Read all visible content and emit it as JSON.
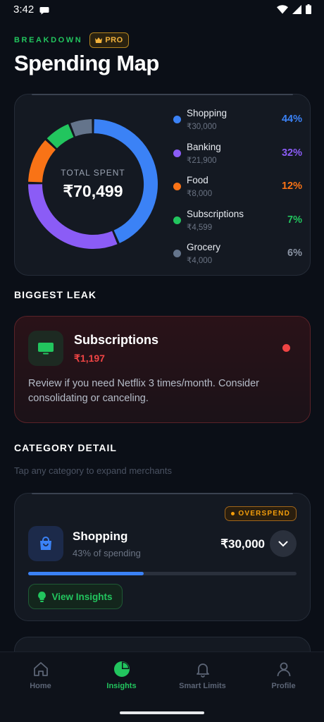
{
  "status_bar": {
    "time": "3:42"
  },
  "header": {
    "eyebrow": "BREAKDOWN",
    "badge": "PRO",
    "title": "Spending Map"
  },
  "donut": {
    "total_label": "TOTAL SPENT",
    "total_value": "₹70,499",
    "categories": [
      {
        "name": "Shopping",
        "amount": "₹30,000",
        "percent": "44%",
        "share": 44,
        "color": "#3b82f6"
      },
      {
        "name": "Banking",
        "amount": "₹21,900",
        "percent": "32%",
        "share": 32,
        "color": "#8b5cf6"
      },
      {
        "name": "Food",
        "amount": "₹8,000",
        "percent": "12%",
        "share": 12,
        "color": "#f97316"
      },
      {
        "name": "Subscriptions",
        "amount": "₹4,599",
        "percent": "7%",
        "share": 7,
        "color": "#22c55e"
      },
      {
        "name": "Grocery",
        "amount": "₹4,000",
        "percent": "6%",
        "share": 6,
        "color": "#64748b"
      }
    ]
  },
  "leak": {
    "heading": "BIGGEST LEAK",
    "name": "Subscriptions",
    "amount": "₹1,197",
    "description": "Review if you need Netflix 3 times/month. Consider consolidating or canceling."
  },
  "detail": {
    "heading": "CATEGORY DETAIL",
    "hint": "Tap any category to expand merchants",
    "card": {
      "badge": "OVERSPEND",
      "name": "Shopping",
      "subtitle": "43% of spending",
      "amount": "₹30,000",
      "progress": 0.43,
      "button": "View Insights"
    }
  },
  "nav": {
    "items": [
      {
        "label": "Home",
        "icon": "home-icon"
      },
      {
        "label": "Insights",
        "icon": "pie-chart-icon",
        "active": true
      },
      {
        "label": "Smart Limits",
        "icon": "bell-icon"
      },
      {
        "label": "Profile",
        "icon": "user-icon"
      }
    ]
  }
}
